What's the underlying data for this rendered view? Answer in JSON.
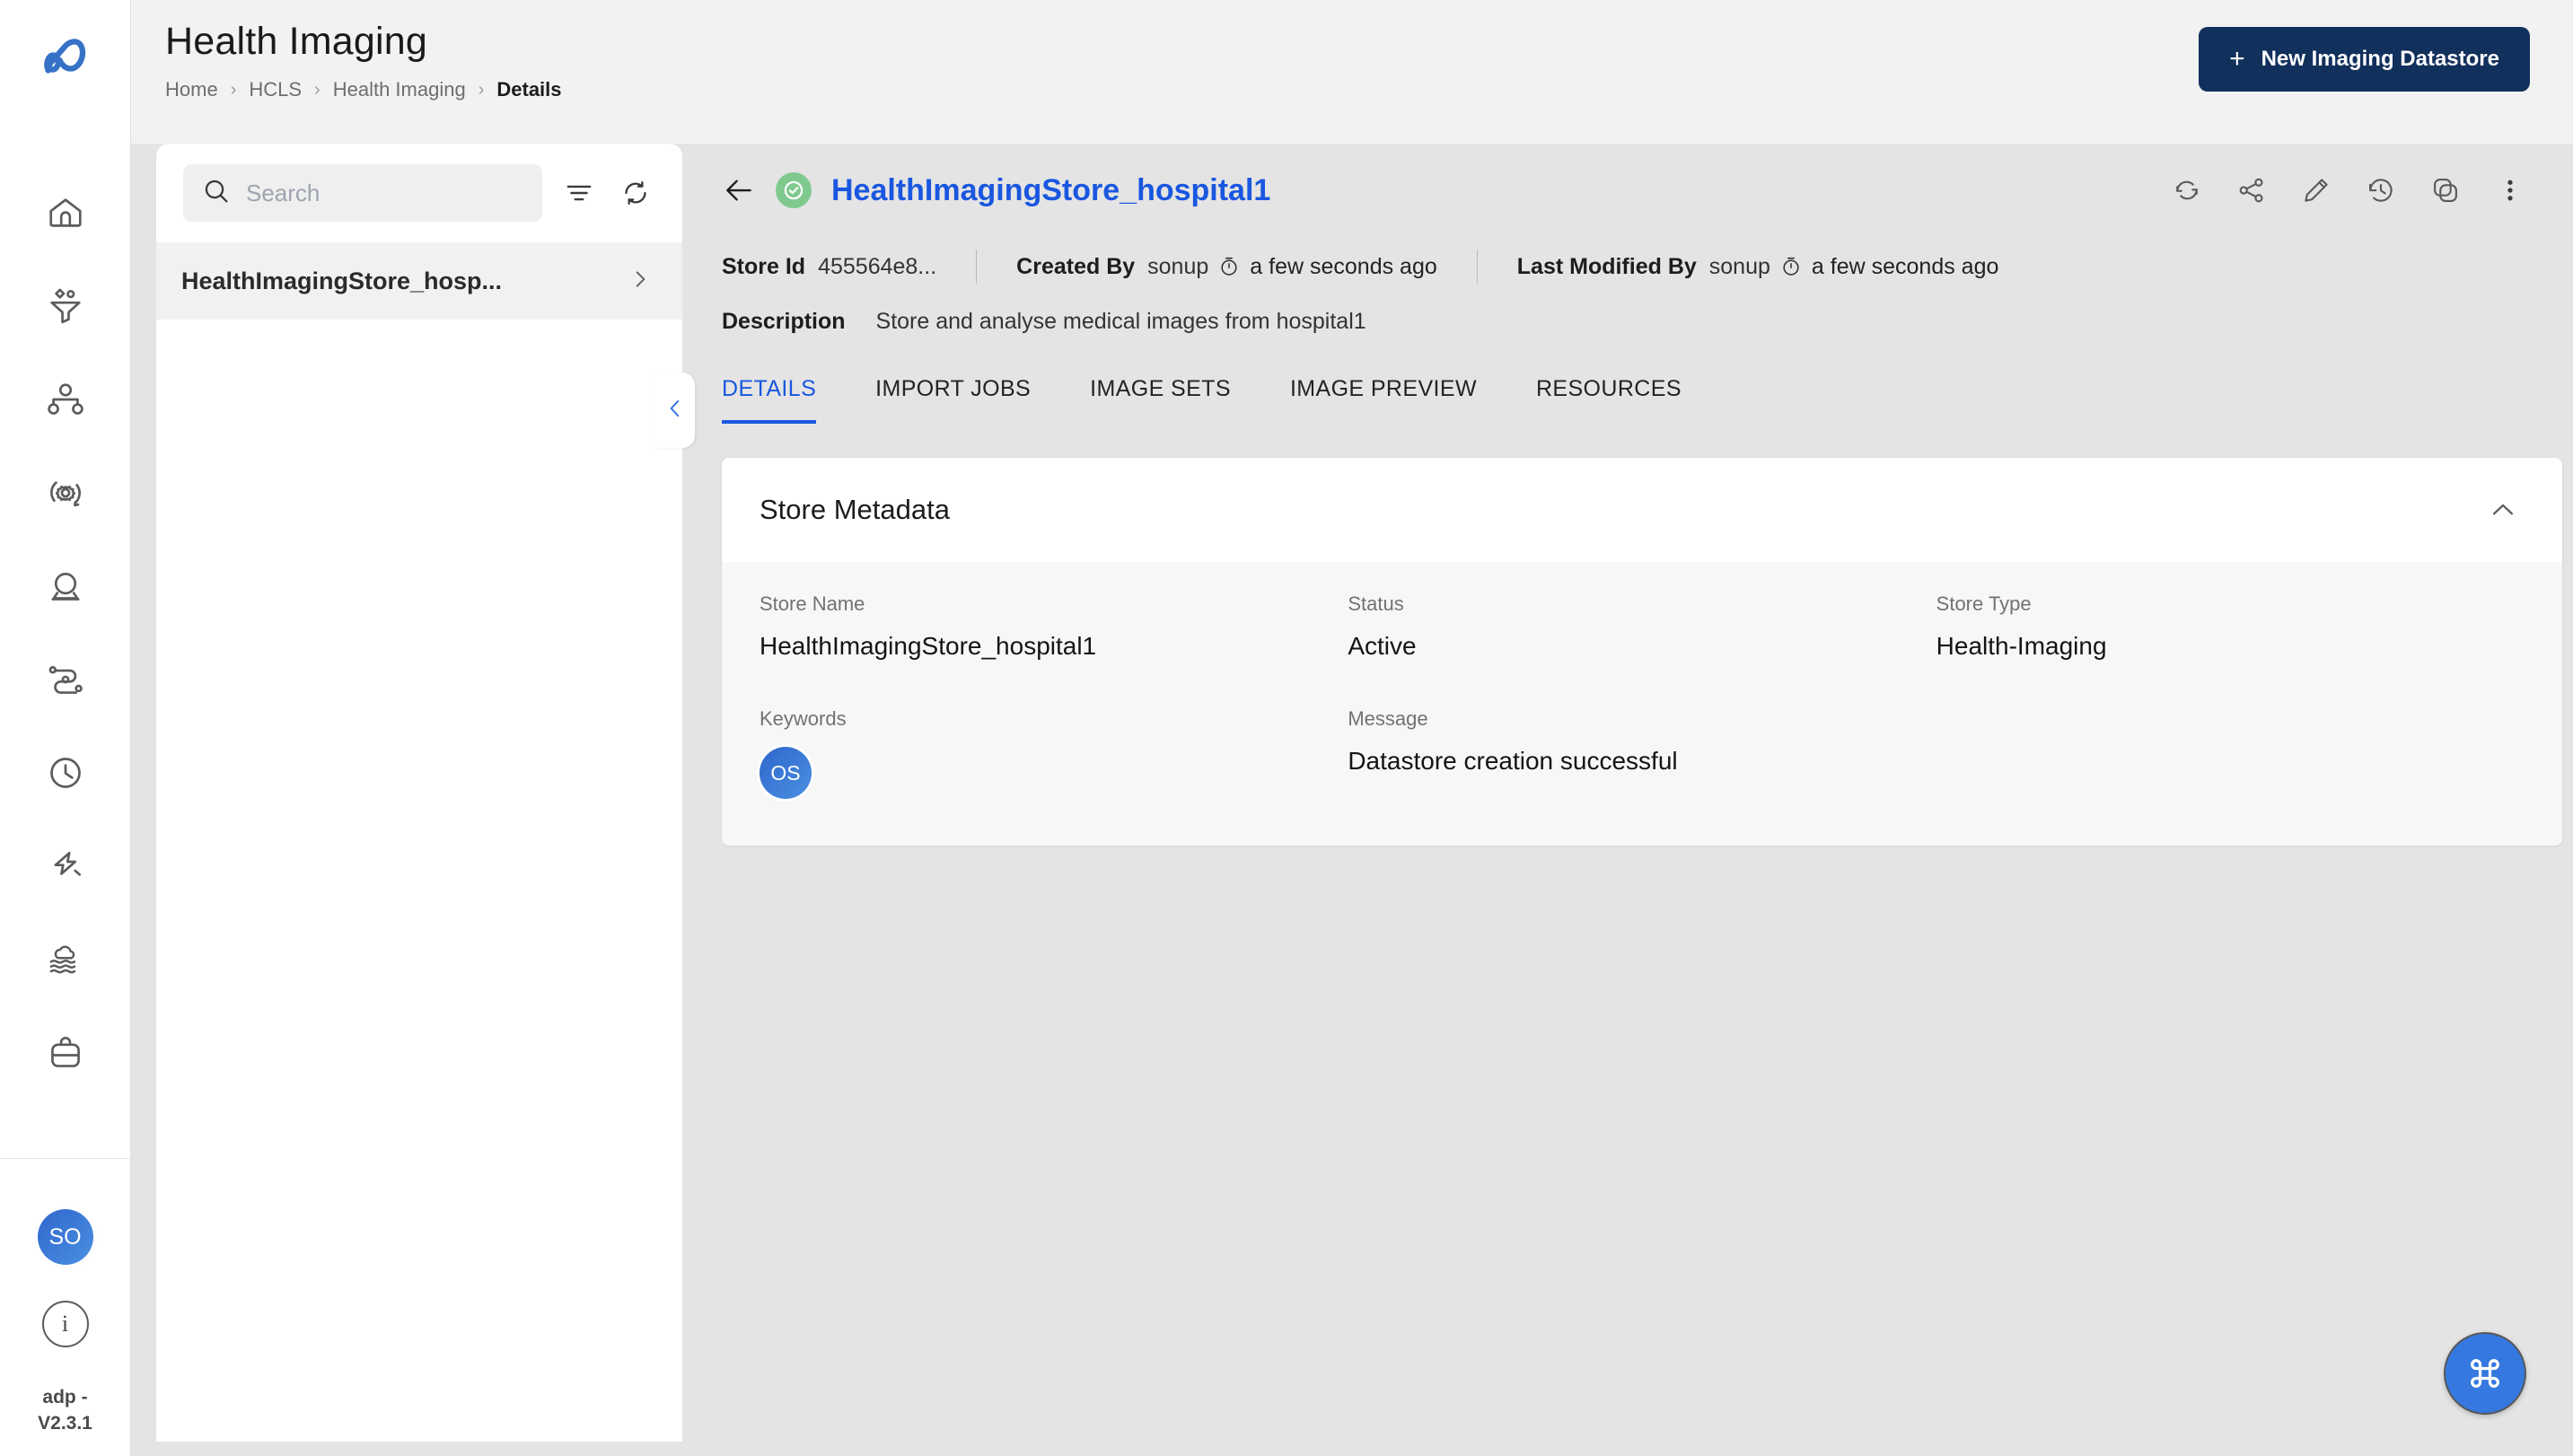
{
  "header": {
    "title": "Health Imaging",
    "breadcrumb": [
      {
        "label": "Home"
      },
      {
        "label": "HCLS"
      },
      {
        "label": "Health Imaging"
      },
      {
        "label": "Details"
      }
    ],
    "separator": "›",
    "new_button_label": "New Imaging Datastore",
    "new_button_plus": "+",
    "accent_color": "#12305c"
  },
  "rail": {
    "logo_name": "adp-logo",
    "items": [
      {
        "icon": "home-icon"
      },
      {
        "icon": "funnel-icon"
      },
      {
        "icon": "hierarchy-icon"
      },
      {
        "icon": "gear-refresh-icon"
      },
      {
        "icon": "crystal-ball-icon"
      },
      {
        "icon": "pipeline-icon"
      },
      {
        "icon": "clock-icon"
      },
      {
        "icon": "lightning-icon"
      },
      {
        "icon": "cloud-waves-icon"
      },
      {
        "icon": "basket-icon"
      }
    ],
    "avatar_initials": "SO",
    "info_glyph": "i",
    "version": "adp - V2.3.1"
  },
  "list_panel": {
    "search_placeholder": "Search",
    "search_value": "",
    "filter_icon": "filter-icon",
    "refresh_icon": "refresh-icon",
    "collapse_icon": "chevron-left-icon",
    "items": [
      {
        "label": "HealthImagingStore_hosp...",
        "chevron": "chevron-right-icon"
      }
    ]
  },
  "detail": {
    "back_icon": "arrow-left-icon",
    "status_icon": "check-circle-icon",
    "title": "HealthImagingStore_hospital1",
    "title_color": "#1a57e0",
    "status_color": "#7fc98f",
    "actions": [
      {
        "icon": "sync-icon"
      },
      {
        "icon": "share-icon"
      },
      {
        "icon": "edit-pencil-icon"
      },
      {
        "icon": "history-icon"
      },
      {
        "icon": "duplicate-icon"
      },
      {
        "icon": "more-vertical-icon"
      }
    ],
    "meta": {
      "store_id_label": "Store Id",
      "store_id_value": "455564e8...",
      "created_by_label": "Created By",
      "created_by_user": "sonup",
      "created_by_time": "a few seconds ago",
      "last_modified_label": "Last Modified By",
      "last_modified_user": "sonup",
      "last_modified_time": "a few seconds ago",
      "description_label": "Description",
      "description_value": "Store and analyse medical images from hospital1"
    },
    "tabs": [
      {
        "label": "DETAILS",
        "active": true
      },
      {
        "label": "IMPORT JOBS",
        "active": false
      },
      {
        "label": "IMAGE SETS",
        "active": false
      },
      {
        "label": "IMAGE PREVIEW",
        "active": false
      },
      {
        "label": "RESOURCES",
        "active": false
      }
    ],
    "card": {
      "title": "Store Metadata",
      "collapse_icon": "chevron-up-icon",
      "fields_row1": [
        {
          "label": "Store Name",
          "value": "HealthImagingStore_hospital1"
        },
        {
          "label": "Status",
          "value": "Active"
        },
        {
          "label": "Store Type",
          "value": "Health-Imaging"
        }
      ],
      "fields_row2": [
        {
          "label": "Keywords",
          "badge": "OS"
        },
        {
          "label": "Message",
          "value": "Datastore creation successful"
        }
      ]
    },
    "fab": {
      "icon": "command-icon",
      "glyph": "⌘",
      "color": "#3478e0"
    }
  }
}
